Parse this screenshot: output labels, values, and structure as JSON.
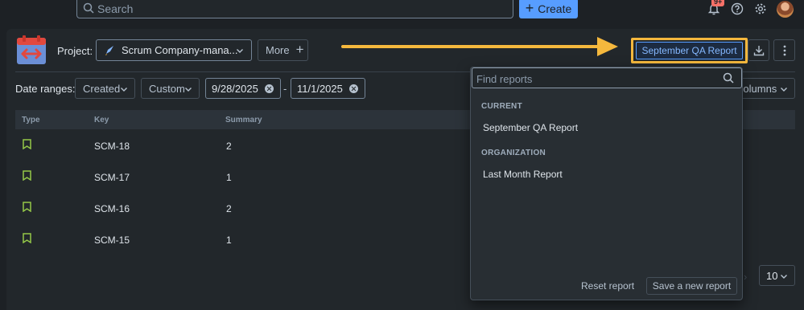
{
  "topbar": {
    "search_placeholder": "Search",
    "create_label": "Create",
    "notification_badge": "9+",
    "icons": [
      "bell-icon",
      "help-icon",
      "gear-icon",
      "avatar"
    ]
  },
  "toolbar": {
    "project_label": "Project:",
    "project_value": "Scrum Company-mana...",
    "more_label": "More",
    "report_button": "September QA Report"
  },
  "filters": {
    "date_ranges_label": "Date ranges:",
    "created_label": "Created",
    "custom_label": "Custom",
    "start_date": "9/28/2025",
    "separator": "-",
    "end_date": "11/1/2025",
    "columns_label": "Columns"
  },
  "table": {
    "headers": [
      "Type",
      "Key",
      "Summary"
    ],
    "rows": [
      {
        "key": "SCM-18",
        "summary": "2"
      },
      {
        "key": "SCM-17",
        "summary": "1"
      },
      {
        "key": "SCM-16",
        "summary": "2"
      },
      {
        "key": "SCM-15",
        "summary": "1"
      }
    ]
  },
  "pagination": {
    "page_size": "10"
  },
  "report_menu": {
    "search_placeholder": "Find reports",
    "current_heading": "CURRENT",
    "current_items": [
      "September QA Report"
    ],
    "org_heading": "ORGANIZATION",
    "org_items": [
      "Last Month Report"
    ],
    "reset_label": "Reset report",
    "save_label": "Save a new report"
  },
  "colors": {
    "accent": "#579dff",
    "highlight": "#f5b83d",
    "story_icon": "#94c748"
  }
}
